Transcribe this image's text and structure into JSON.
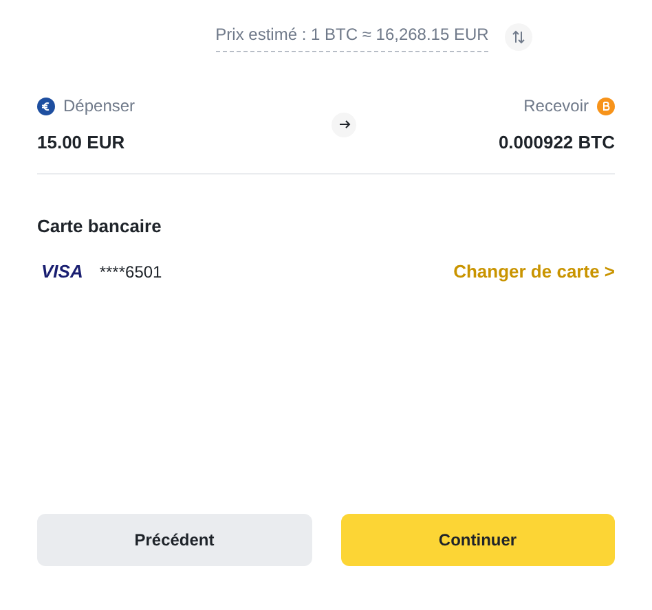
{
  "price_estimate": "Prix estimé : 1 BTC ≈ 16,268.15 EUR",
  "spend": {
    "label": "Dépenser",
    "value": "15.00 EUR"
  },
  "receive": {
    "label": "Recevoir",
    "value": "0.000922 BTC"
  },
  "payment": {
    "heading": "Carte bancaire",
    "brand": "VISA",
    "card_number": "****6501",
    "change_link": "Changer de carte >"
  },
  "buttons": [
    {
      "label": "Précédent",
      "kind": "secondary"
    },
    {
      "label": "Continuer",
      "kind": "primary"
    }
  ]
}
